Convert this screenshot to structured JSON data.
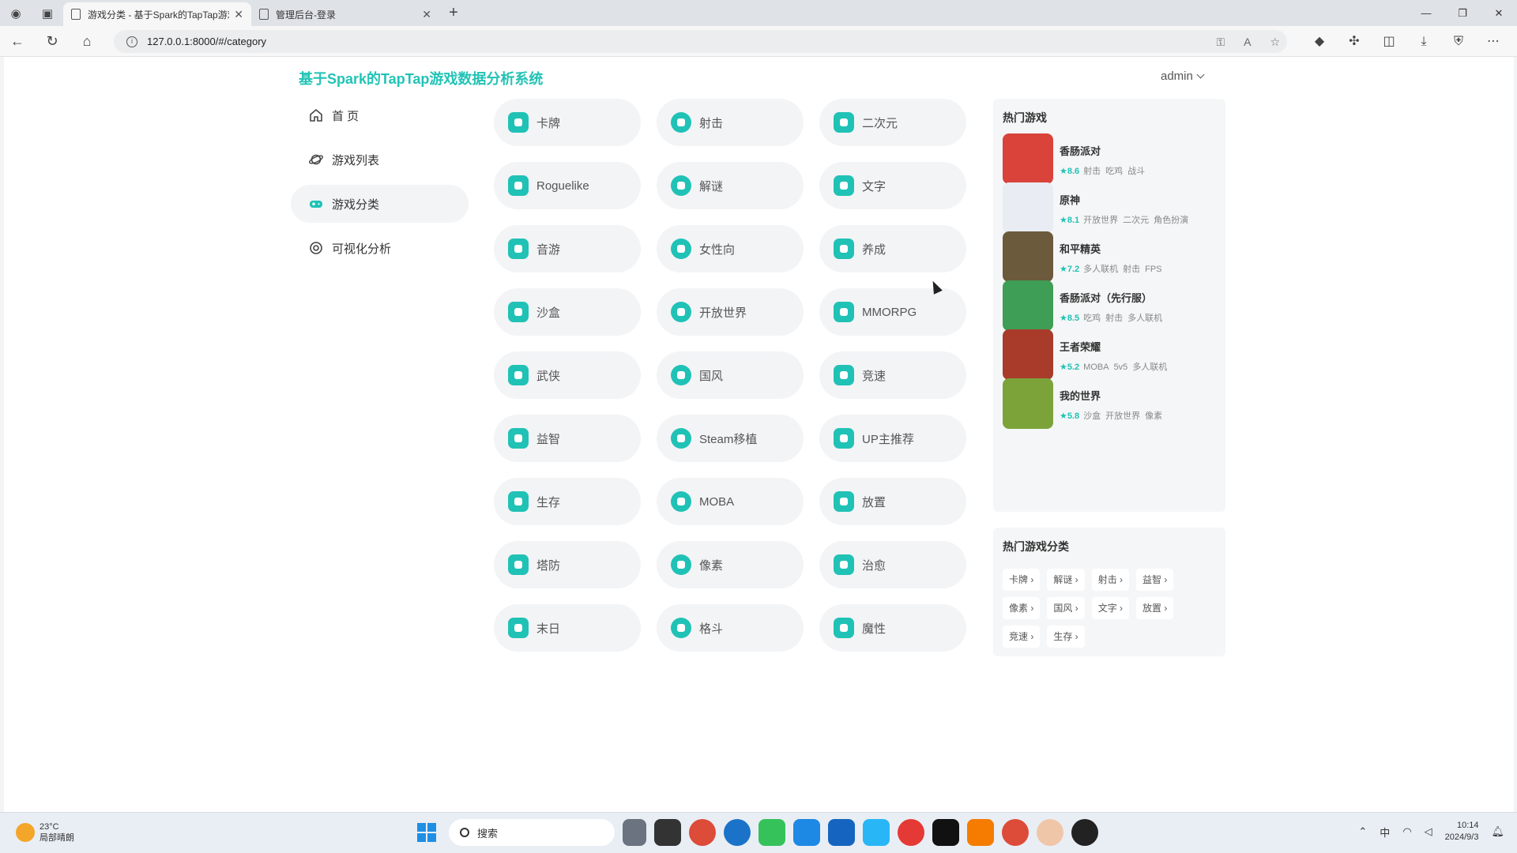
{
  "browser": {
    "tabs": [
      {
        "title": "游戏分类 - 基于Spark的TapTap游戏",
        "active": true
      },
      {
        "title": "管理后台-登录",
        "active": false
      }
    ],
    "url": "127.0.0.1:8000/#/category"
  },
  "header": {
    "brand": "基于Spark的TapTap游戏数据分析系统",
    "user": "admin"
  },
  "sidebar": {
    "items": [
      {
        "label": "首 页",
        "icon": "home-icon",
        "active": false
      },
      {
        "label": "游戏列表",
        "icon": "planet-icon",
        "active": false
      },
      {
        "label": "游戏分类",
        "icon": "gamepad-icon",
        "active": true
      },
      {
        "label": "可视化分析",
        "icon": "chart-icon",
        "active": false
      }
    ]
  },
  "categories": [
    {
      "label": "卡牌",
      "icon": "cards-icon"
    },
    {
      "label": "射击",
      "icon": "crosshair-icon"
    },
    {
      "label": "二次元",
      "icon": "anime-icon"
    },
    {
      "label": "Roguelike",
      "icon": "dice-icon"
    },
    {
      "label": "解谜",
      "icon": "bulb-icon"
    },
    {
      "label": "文字",
      "icon": "text-icon"
    },
    {
      "label": "音游",
      "icon": "music-icon"
    },
    {
      "label": "女性向",
      "icon": "bow-icon"
    },
    {
      "label": "养成",
      "icon": "sprout-icon"
    },
    {
      "label": "沙盒",
      "icon": "sandbox-icon"
    },
    {
      "label": "开放世界",
      "icon": "globe-icon"
    },
    {
      "label": "MMORPG",
      "icon": "mmorpg-icon"
    },
    {
      "label": "武侠",
      "icon": "sword-icon"
    },
    {
      "label": "国风",
      "icon": "pavilion-icon"
    },
    {
      "label": "竞速",
      "icon": "flag-icon"
    },
    {
      "label": "益智",
      "icon": "puzzle-icon"
    },
    {
      "label": "Steam移植",
      "icon": "steam-icon"
    },
    {
      "label": "UP主推荐",
      "icon": "thumb-icon"
    },
    {
      "label": "生存",
      "icon": "survival-icon"
    },
    {
      "label": "MOBA",
      "icon": "moba-icon"
    },
    {
      "label": "放置",
      "icon": "clock-icon"
    },
    {
      "label": "塔防",
      "icon": "tower-icon"
    },
    {
      "label": "像素",
      "icon": "pixel-icon"
    },
    {
      "label": "治愈",
      "icon": "heart-icon"
    },
    {
      "label": "末日",
      "icon": "doom-icon"
    },
    {
      "label": "格斗",
      "icon": "fight-icon"
    },
    {
      "label": "魔性",
      "icon": "magic-icon"
    }
  ],
  "hot_games": {
    "title": "热门游戏",
    "items": [
      {
        "name": "香肠派对",
        "score": "★8.6",
        "tags": [
          "射击",
          "吃鸡",
          "战斗"
        ],
        "color": "#d9433a"
      },
      {
        "name": "原神",
        "score": "★8.1",
        "tags": [
          "开放世界",
          "二次元",
          "角色扮演"
        ],
        "color": "#e9ecf3"
      },
      {
        "name": "和平精英",
        "score": "★7.2",
        "tags": [
          "多人联机",
          "射击",
          "FPS"
        ],
        "color": "#6b5a3b"
      },
      {
        "name": "香肠派对（先行服）",
        "score": "★8.5",
        "tags": [
          "吃鸡",
          "射击",
          "多人联机"
        ],
        "color": "#3f9e55"
      },
      {
        "name": "王者荣耀",
        "score": "★5.2",
        "tags": [
          "MOBA",
          "5v5",
          "多人联机"
        ],
        "color": "#a83b2a"
      },
      {
        "name": "我的世界",
        "score": "★5.8",
        "tags": [
          "沙盒",
          "开放世界",
          "像素"
        ],
        "color": "#7ba33a"
      }
    ]
  },
  "hot_categories": {
    "title": "热门游戏分类",
    "items": [
      "卡牌 ›",
      "解谜 ›",
      "射击 ›",
      "益智 ›",
      "像素 ›",
      "国风 ›",
      "文字 ›",
      "放置 ›",
      "竞速 ›",
      "生存 ›"
    ]
  },
  "taskbar": {
    "temp": "23°C",
    "weather": "局部晴朗",
    "search": "搜索",
    "ime": "中",
    "time": "10:14",
    "date": "2024/9/3"
  },
  "colors": {
    "accent": "#20c2b6",
    "brand": "#22c3b5"
  }
}
